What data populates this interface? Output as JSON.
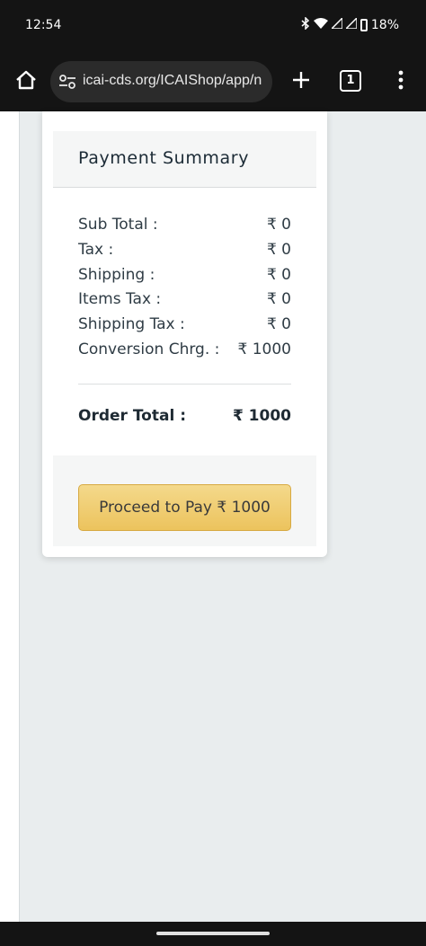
{
  "status_bar": {
    "time": "12:54",
    "battery": "18%",
    "icons": [
      "bluetooth-icon",
      "wifi-icon",
      "signal-icon",
      "signal-icon",
      "battery-icon"
    ]
  },
  "browser": {
    "url": "icai-cds.org/ICAIShop/app/n",
    "tab_count": "1",
    "icons": [
      "home-icon",
      "tune-icon",
      "plus-icon",
      "more-vert-icon"
    ]
  },
  "summary": {
    "title": "Payment Summary",
    "rows": [
      {
        "label": "Sub Total :",
        "value": "₹ 0"
      },
      {
        "label": "Tax :",
        "value": "₹ 0"
      },
      {
        "label": "Shipping :",
        "value": "₹ 0"
      },
      {
        "label": "Items Tax :",
        "value": "₹ 0"
      },
      {
        "label": "Shipping Tax :",
        "value": "₹ 0"
      },
      {
        "label": "Conversion Chrg. :",
        "value": "₹ 1000"
      }
    ],
    "order_total_label": "Order Total :",
    "order_total_value": "₹ 1000",
    "pay_button": "Proceed to Pay ₹ 1000"
  },
  "colors": {
    "pay_button": "#ecc35d",
    "page_background": "#e9edee",
    "system_bar": "#141414"
  }
}
